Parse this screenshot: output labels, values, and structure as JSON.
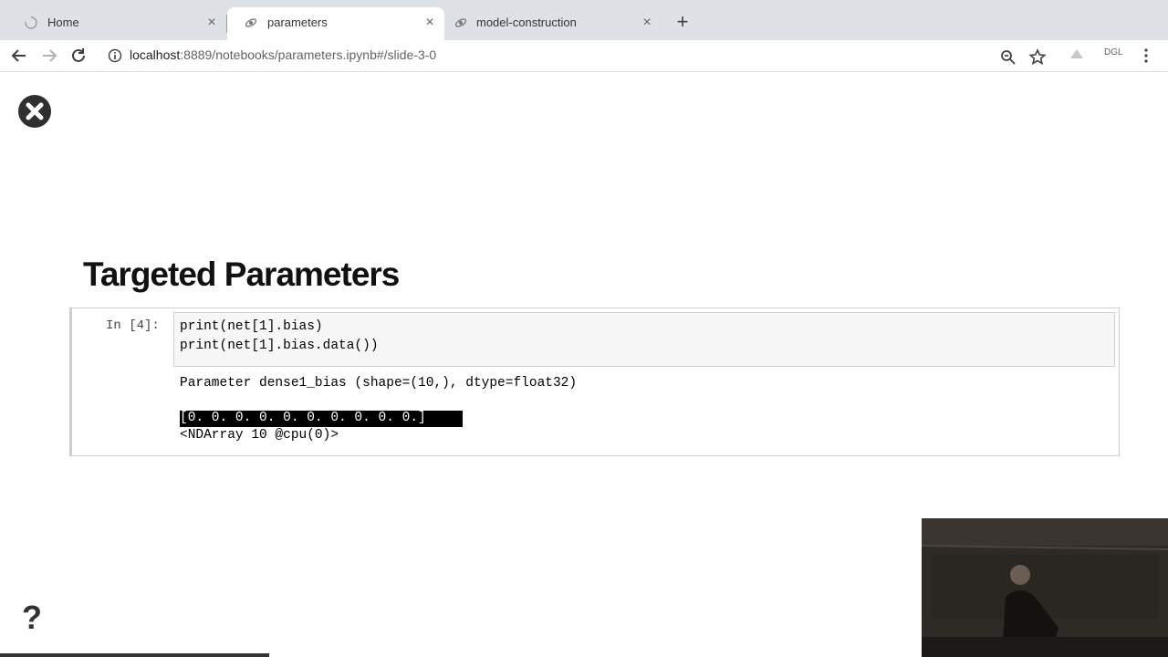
{
  "tabs": [
    {
      "label": "Home",
      "icon": "loading-icon",
      "active": false
    },
    {
      "label": "parameters",
      "icon": "jupyter-icon",
      "active": true
    },
    {
      "label": "model-construction",
      "icon": "jupyter-icon",
      "active": false
    }
  ],
  "toolbar": {
    "url_host": "localhost",
    "url_rest": ":8889/notebooks/parameters.ipynb#/slide-3-0",
    "profile_label": "DGL"
  },
  "slide": {
    "title": "Targeted Parameters",
    "cell": {
      "prompt": "In [4]:",
      "code_lines": [
        "print(net[1].bias)",
        "print(net[1].bias.data())"
      ],
      "output_lines": [
        "Parameter dense1_bias (shape=(10,), dtype=float32)",
        "[0. 0. 0. 0. 0. 0. 0. 0. 0. 0.]",
        "<NDArray 10 @cpu(0)>"
      ]
    },
    "help_label": "?"
  },
  "colors": {
    "tabstrip_bg": "#dee1e6",
    "cell_border": "#cfcfcf",
    "input_bg": "#f7f7f7",
    "selection": "#000000"
  }
}
